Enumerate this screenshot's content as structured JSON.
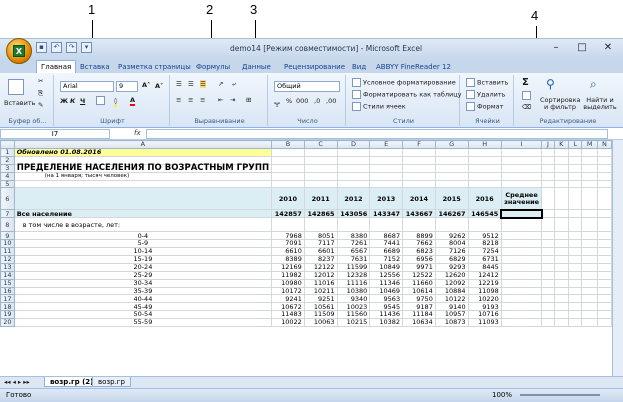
{
  "callouts": [
    "1",
    "2",
    "3",
    "4"
  ],
  "window": {
    "title": "demo14 [Режим совместимости] - Microsoft Excel",
    "minimize": "–",
    "maximize": "□",
    "close": "✕"
  },
  "app_logo": "X",
  "tabs": [
    "Главная",
    "Вставка",
    "Разметка страницы",
    "Формулы",
    "Данные",
    "Рецензирование",
    "Вид",
    "ABBYY FineReader 12"
  ],
  "ribbon": {
    "paste": "Вставить",
    "font_name": "Arial",
    "font_size": "9",
    "number_format": "Общий",
    "groups": {
      "clipboard": "Буфер об...",
      "font": "Шрифт",
      "align": "Выравнивание",
      "number": "Число",
      "styles": "Стили",
      "cells": "Ячейки",
      "edit": "Редактирование"
    },
    "styles_items": [
      "Условное форматирование",
      "Форматировать как таблицу",
      "Стили ячеек"
    ],
    "cells_items": [
      "Вставить",
      "Удалить",
      "Формат"
    ],
    "edit_items": [
      "Сортировка и фильтр",
      "Найти и выделить"
    ],
    "sigma": "Σ"
  },
  "formula_bar": {
    "name_box": "I7",
    "fx": "fx"
  },
  "columns": [
    "",
    "A",
    "B",
    "C",
    "D",
    "E",
    "F",
    "G",
    "H",
    "I",
    "J",
    "K",
    "L",
    "M",
    "N"
  ],
  "rows": [
    {
      "n": "1",
      "a": "Обновлено 01.08.2016"
    },
    {
      "n": "2",
      "a": ""
    },
    {
      "n": "3",
      "a": "ПРЕДЕЛЕНИЕ НАСЕЛЕНИЯ ПО ВОЗРАСТНЫМ ГРУПП"
    },
    {
      "n": "4",
      "a": "(на 1 января; тысяч человек)"
    },
    {
      "n": "5",
      "a": ""
    },
    {
      "n": "6",
      "a": "",
      "years": [
        "2010",
        "2011",
        "2012",
        "2013",
        "2014",
        "2015",
        "2016"
      ],
      "i": "Среднее значение"
    },
    {
      "n": "7",
      "a": "Все население",
      "vals": [
        "142857",
        "142865",
        "143056",
        "143347",
        "143667",
        "146267",
        "146545"
      ]
    },
    {
      "n": "8",
      "a": "в том числе в возрасте, лет:"
    },
    {
      "n": "9",
      "a": "0-4",
      "vals": [
        "7968",
        "8051",
        "8380",
        "8687",
        "8899",
        "9262",
        "9512"
      ]
    },
    {
      "n": "10",
      "a": "5-9",
      "vals": [
        "7091",
        "7117",
        "7261",
        "7441",
        "7662",
        "8004",
        "8218"
      ]
    },
    {
      "n": "11",
      "a": "10-14",
      "vals": [
        "6610",
        "6601",
        "6567",
        "6689",
        "6823",
        "7126",
        "7254"
      ]
    },
    {
      "n": "12",
      "a": "15-19",
      "vals": [
        "8389",
        "8237",
        "7631",
        "7152",
        "6956",
        "6829",
        "6731"
      ]
    },
    {
      "n": "13",
      "a": "20-24",
      "vals": [
        "12169",
        "12122",
        "11599",
        "10849",
        "9971",
        "9293",
        "8445"
      ]
    },
    {
      "n": "14",
      "a": "25-29",
      "vals": [
        "11982",
        "12012",
        "12328",
        "12556",
        "12522",
        "12620",
        "12412"
      ]
    },
    {
      "n": "15",
      "a": "30-34",
      "vals": [
        "10980",
        "11016",
        "11116",
        "11346",
        "11660",
        "12092",
        "12219"
      ]
    },
    {
      "n": "16",
      "a": "35-39",
      "vals": [
        "10172",
        "10211",
        "10380",
        "10469",
        "10614",
        "10884",
        "11098"
      ]
    },
    {
      "n": "17",
      "a": "40-44",
      "vals": [
        "9241",
        "9251",
        "9340",
        "9563",
        "9750",
        "10122",
        "10220"
      ]
    },
    {
      "n": "18",
      "a": "45-49",
      "vals": [
        "10672",
        "10561",
        "10023",
        "9545",
        "9187",
        "9140",
        "9193"
      ]
    },
    {
      "n": "19",
      "a": "50-54",
      "vals": [
        "11483",
        "11509",
        "11560",
        "11436",
        "11184",
        "10957",
        "10716"
      ]
    },
    {
      "n": "20",
      "a": "55-59",
      "vals": [
        "10022",
        "10063",
        "10215",
        "10382",
        "10634",
        "10873",
        "11093"
      ]
    }
  ],
  "sheets": [
    "возр.гр (2)",
    "возр.гр"
  ],
  "status": {
    "ready": "Готово",
    "zoom": "100%"
  }
}
